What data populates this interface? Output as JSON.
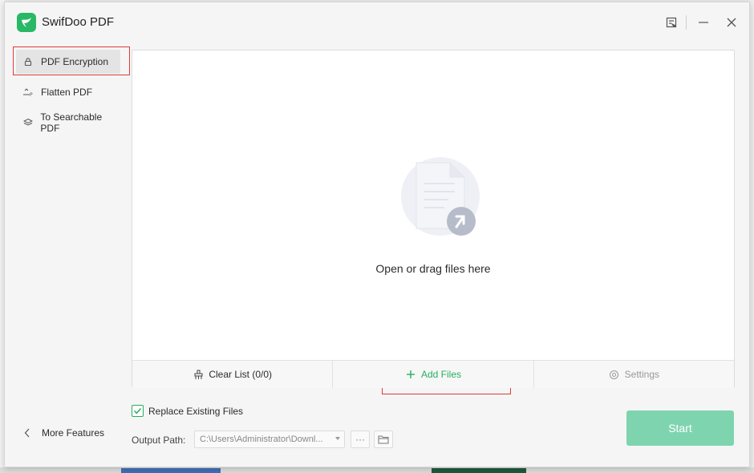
{
  "app": {
    "title": "SwifDoo PDF"
  },
  "colors": {
    "accent": "#27ae60",
    "start_disabled": "#7fd4b0",
    "highlight_red": "#e03a3a"
  },
  "sidebar": {
    "items": [
      {
        "label": "PDF Encryption",
        "icon": "lock-icon",
        "active": true
      },
      {
        "label": "Flatten PDF",
        "icon": "flatten-icon",
        "active": false
      },
      {
        "label": "To Searchable PDF",
        "icon": "layers-icon",
        "active": false
      }
    ],
    "more_features": "More Features"
  },
  "dropzone": {
    "hint": "Open or drag files here"
  },
  "actions": {
    "clear_list": "Clear List (0/0)",
    "add_files": "Add Files",
    "settings": "Settings"
  },
  "options": {
    "replace_existing": "Replace Existing Files",
    "replace_checked": true,
    "output_label": "Output Path:",
    "output_value": "C:\\Users\\Administrator\\Downl...",
    "more_button": "···"
  },
  "start": {
    "label": "Start"
  }
}
